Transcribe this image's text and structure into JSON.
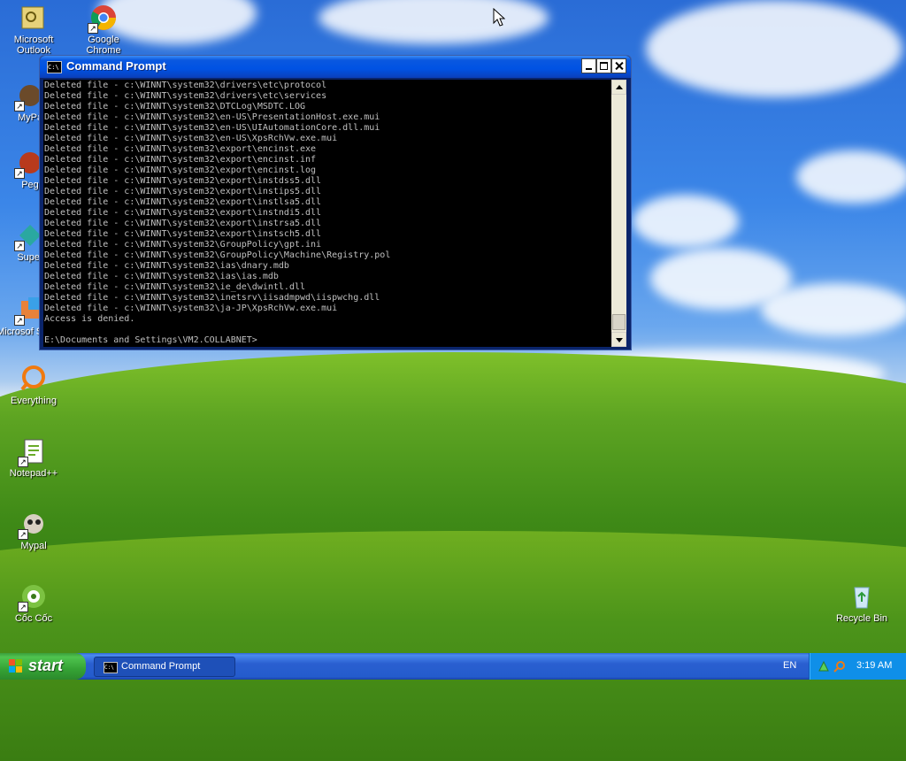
{
  "desktop": {
    "icons": [
      {
        "label": "Microsoft Outlook"
      },
      {
        "label": "Google Chrome"
      },
      {
        "label": "MyPa"
      },
      {
        "label": "Peg"
      },
      {
        "label": "Super"
      },
      {
        "label": "Microsof Studio"
      },
      {
        "label": "Everything"
      },
      {
        "label": "Notepad++"
      },
      {
        "label": "Mypal"
      },
      {
        "label": "Cốc Cốc"
      },
      {
        "label": "Recycle Bin"
      }
    ]
  },
  "window": {
    "title": "Command Prompt",
    "icon": "command-prompt-icon",
    "console_text": "Deleted file - c:\\WINNT\\system32\\drivers\\etc\\protocol\nDeleted file - c:\\WINNT\\system32\\drivers\\etc\\services\nDeleted file - c:\\WINNT\\system32\\DTCLog\\MSDTC.LOG\nDeleted file - c:\\WINNT\\system32\\en-US\\PresentationHost.exe.mui\nDeleted file - c:\\WINNT\\system32\\en-US\\UIAutomationCore.dll.mui\nDeleted file - c:\\WINNT\\system32\\en-US\\XpsRchVw.exe.mui\nDeleted file - c:\\WINNT\\system32\\export\\encinst.exe\nDeleted file - c:\\WINNT\\system32\\export\\encinst.inf\nDeleted file - c:\\WINNT\\system32\\export\\encinst.log\nDeleted file - c:\\WINNT\\system32\\export\\instdss5.dll\nDeleted file - c:\\WINNT\\system32\\export\\instips5.dll\nDeleted file - c:\\WINNT\\system32\\export\\instlsa5.dll\nDeleted file - c:\\WINNT\\system32\\export\\instndi5.dll\nDeleted file - c:\\WINNT\\system32\\export\\instrsa5.dll\nDeleted file - c:\\WINNT\\system32\\export\\instsch5.dll\nDeleted file - c:\\WINNT\\system32\\GroupPolicy\\gpt.ini\nDeleted file - c:\\WINNT\\system32\\GroupPolicy\\Machine\\Registry.pol\nDeleted file - c:\\WINNT\\system32\\ias\\dnary.mdb\nDeleted file - c:\\WINNT\\system32\\ias\\ias.mdb\nDeleted file - c:\\WINNT\\system32\\ie_de\\dwintl.dll\nDeleted file - c:\\WINNT\\system32\\inetsrv\\iisadmpwd\\iispwchg.dll\nDeleted file - c:\\WINNT\\system32\\ja-JP\\XpsRchVw.exe.mui\nAccess is denied.\n\nE:\\Documents and Settings\\VM2.COLLABNET>"
  },
  "taskbar": {
    "start_label": "start",
    "task_label": "Command Prompt",
    "language": "EN",
    "clock": "3:19 AM"
  },
  "colors": {
    "console_bg": "#000000",
    "console_text": "#c0c0c0",
    "titlebar": "#0052e3",
    "taskbar": "#245ccc",
    "start_button": "#35a335"
  }
}
